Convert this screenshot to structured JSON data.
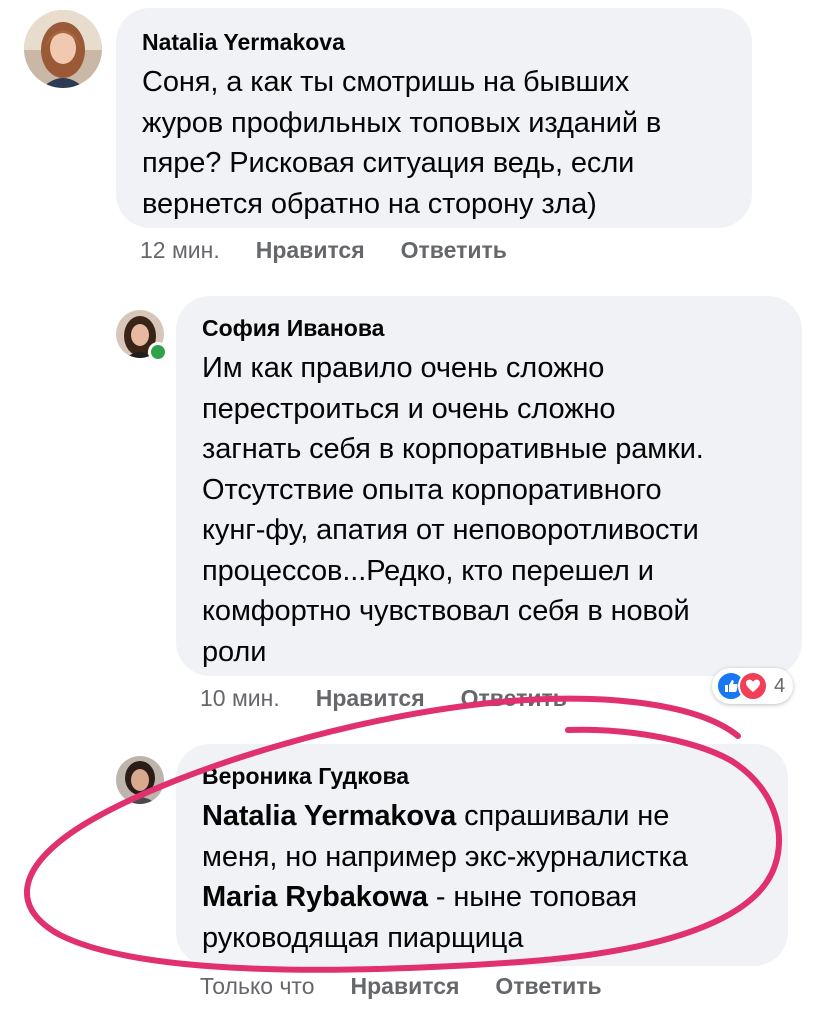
{
  "comments": [
    {
      "author": "Natalia Yermakova",
      "lines": [
        "Соня, а как ты смотришь на бывших",
        "журов профильных топовых изданий в",
        "пяре? Рисковая ситуация ведь, если",
        "вернется обратно на сторону зла)"
      ],
      "time": "12 мин.",
      "like_label": "Нравится",
      "reply_label": "Ответить"
    },
    {
      "author": "София Иванова",
      "lines": [
        "Им как правило очень сложно",
        "перестроиться и очень сложно",
        "загнать себя в корпоративные рамки.",
        "Отсутствие опыта корпоративного",
        "кунг-фу, апатия от неповоротливости",
        "процессов...Редко, кто перешел и",
        "комфортно чувствовал себя в новой",
        "роли"
      ],
      "time": "10 мин.",
      "like_label": "Нравится",
      "reply_label": "Ответить",
      "reactions": {
        "count": "4",
        "types": [
          "like-icon",
          "love-icon"
        ]
      },
      "online": true
    },
    {
      "author": "Вероника Гудкова",
      "mention_1": "Natalia Yermakova",
      "line_1_rest": " спрашивали не",
      "line_2": "меня, но например экс-журналистка",
      "mention_2": "Maria Rybakowa",
      "line_3_rest": " - ныне топовая",
      "line_4": "руководящая пиарщица",
      "time": "Только что",
      "like_label": "Нравится",
      "reply_label": "Ответить"
    }
  ],
  "colors": {
    "bubble": "#f0f2f5",
    "meta_text": "#65676b",
    "annotation": "#e0306f",
    "online": "#31a24c",
    "like_reaction": "#1877f2",
    "love_reaction": "#f33e58"
  }
}
